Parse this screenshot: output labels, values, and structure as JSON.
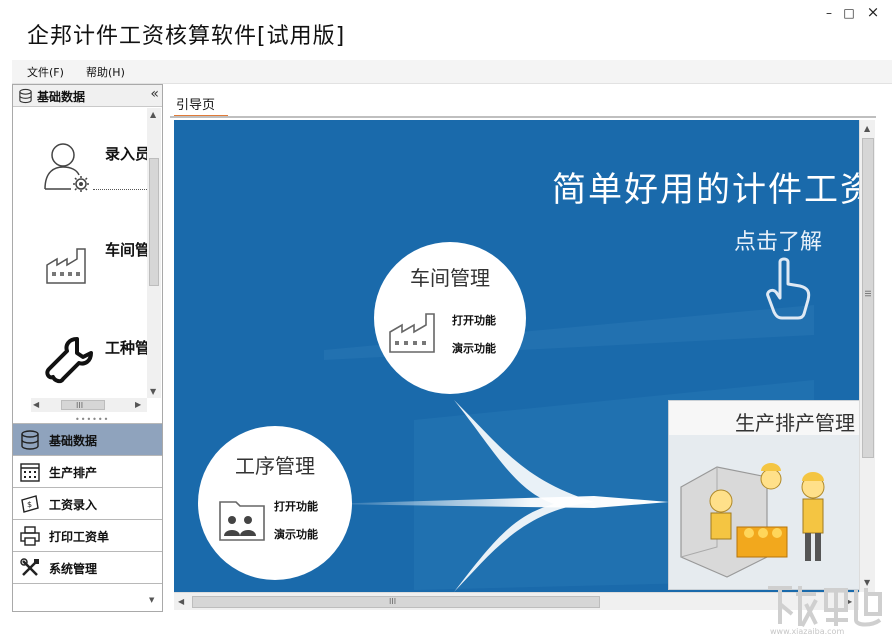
{
  "window": {
    "title": "企邦计件工资核算软件[试用版]",
    "minimize_glyph": "–",
    "maximize_glyph": "□",
    "close_glyph": "×"
  },
  "menu": {
    "items": [
      {
        "label": "文件(F)"
      },
      {
        "label": "帮助(H)"
      }
    ]
  },
  "left_panel": {
    "header_title": "基础数据",
    "collapse_glyph": "«",
    "modules": [
      {
        "label": "录入员",
        "icon": "user-settings-icon"
      },
      {
        "label": "车间管",
        "icon": "factory-icon"
      },
      {
        "label": "工种管",
        "icon": "wrench-icon"
      }
    ],
    "scroll_grip": "III",
    "splitter": "••••••",
    "nav": [
      {
        "label": "基础数据",
        "icon": "database-icon",
        "active": true
      },
      {
        "label": "生产排产",
        "icon": "calendar-icon",
        "active": false
      },
      {
        "label": "工资录入",
        "icon": "money-icon",
        "active": false
      },
      {
        "label": "打印工资单",
        "icon": "printer-icon",
        "active": false
      },
      {
        "label": "系统管理",
        "icon": "tools-icon",
        "active": false
      }
    ]
  },
  "main": {
    "tabs": [
      {
        "label": "引导页",
        "active": true
      }
    ],
    "guide": {
      "headline": "简单好用的计件工资",
      "learn_more": "点击了解",
      "workshop": {
        "title": "车间管理",
        "open": "打开功能",
        "demo": "演示功能"
      },
      "process": {
        "title": "工序管理",
        "open": "打开功能",
        "demo": "演示功能"
      },
      "production": {
        "title": "生产排产管理"
      }
    },
    "scroll_grip": "III"
  },
  "colors": {
    "canvas_bg": "#1a6aab",
    "tab_accent": "#e07b39",
    "nav_active": "#8fa3bd"
  }
}
